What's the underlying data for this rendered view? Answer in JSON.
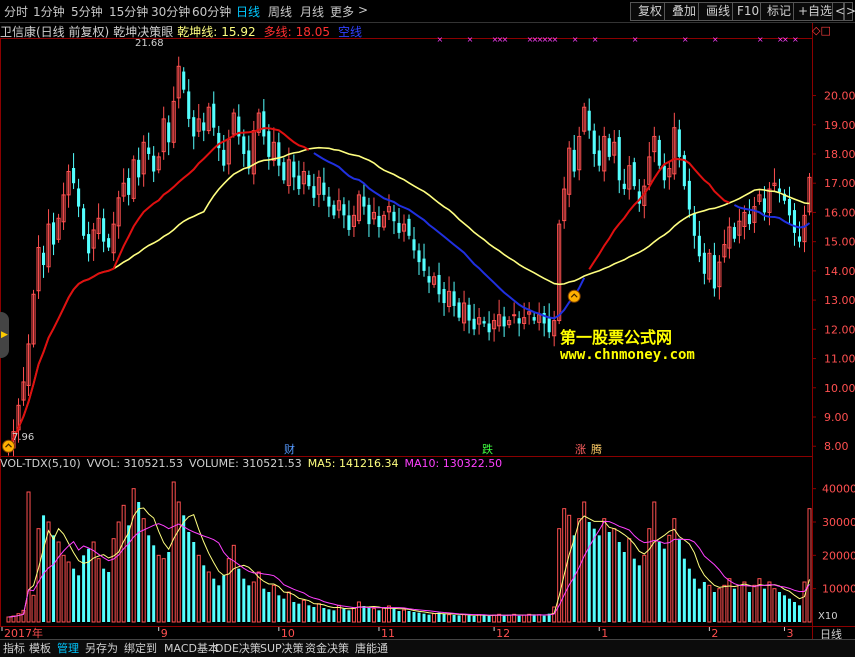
{
  "toolbar": {
    "timeframes": [
      "分时",
      "1分钟",
      "5分钟",
      "15分钟",
      "30分钟",
      "60分钟",
      "日线",
      "周线",
      "月线",
      "更多"
    ],
    "active_timeframe": "日线",
    "more_arrow": ">",
    "buttons": [
      "复权",
      "叠加",
      "画线",
      "F10",
      "标记",
      "+自选"
    ],
    "nav_left": "<",
    "nav_right": ">"
  },
  "legend": {
    "title": "卫信康(日线 前复权)",
    "indicator": "乾坤决策眼",
    "qiankun_label": "乾坤线:",
    "qiankun_value": "15.92",
    "duo_label": "多线:",
    "duo_value": "18.05",
    "kong_label": "空线",
    "corner_mark": "◇□"
  },
  "volume_legend": {
    "name": "VOL-TDX(5,10)",
    "vvol": "VVOL: 310521.53",
    "volume": "VOLUME: 310521.53",
    "ma5": "MA5: 141216.34",
    "ma10": "MA10: 130322.50"
  },
  "price_axis": [
    "20.00",
    "19.00",
    "18.00",
    "17.00",
    "16.00",
    "15.00",
    "14.00",
    "13.00",
    "12.00",
    "11.00",
    "10.00",
    "9.00",
    "8.00"
  ],
  "volume_axis": [
    "40000",
    "30000",
    "20000",
    "10000"
  ],
  "volume_unit": "X10",
  "date_axis": [
    "2017年",
    "9",
    "10",
    "11",
    "12",
    "1",
    "2",
    "3"
  ],
  "period_label": "日线",
  "annotations": {
    "high": "21.68",
    "low": "7.96",
    "events": [
      "财",
      "跌",
      "涨",
      "腾"
    ]
  },
  "watermark": {
    "line1": "第一股票公式网",
    "line2": "www.chnmoney.com"
  },
  "bottom_tabs": [
    "指标",
    "模板",
    "管理",
    "另存为",
    "绑定到",
    "MACD基本",
    "DDE决策",
    "SUP决策",
    "资金决策",
    "唐能通"
  ],
  "active_bottom_tab": "管理",
  "colors": {
    "up": "#ff5050",
    "down": "#54ffff",
    "duo_line": "#e01010",
    "qiankun_line": "#ffff80",
    "kong_line": "#2030e0",
    "ma10": "#ff40ff",
    "grid": "#8b0000"
  },
  "chart_data": {
    "type": "candlestick",
    "price_range": [
      7.7,
      21.9
    ],
    "closes": [
      8.0,
      8.5,
      9.4,
      10.2,
      11.5,
      13.2,
      14.8,
      14.2,
      15.6,
      14.9,
      15.8,
      16.6,
      17.4,
      17.0,
      16.2,
      15.2,
      14.6,
      15.4,
      15.8,
      15.0,
      14.8,
      15.6,
      16.5,
      17.0,
      16.6,
      17.8,
      17.2,
      18.4,
      18.0,
      17.4,
      17.9,
      19.2,
      18.4,
      19.8,
      21.0,
      20.2,
      19.2,
      18.6,
      19.2,
      18.8,
      19.6,
      18.9,
      18.2,
      17.6,
      18.5,
      19.4,
      18.6,
      18.0,
      17.5,
      18.8,
      19.4,
      18.6,
      17.9,
      18.4,
      17.6,
      17.1,
      17.8,
      17.2,
      16.8,
      17.4,
      16.9,
      16.5,
      17.2,
      16.6,
      16.2,
      15.9,
      16.4,
      15.9,
      15.4,
      15.9,
      16.6,
      16.2,
      15.6,
      16.0,
      15.5,
      15.9,
      16.2,
      15.7,
      15.3,
      15.6,
      15.2,
      14.7,
      14.3,
      14.0,
      13.6,
      13.8,
      13.2,
      12.9,
      13.3,
      12.8,
      12.4,
      12.9,
      12.3,
      12.0,
      12.4,
      12.2,
      11.9,
      12.3,
      12.5,
      12.1,
      12.3,
      12.5,
      12.2,
      12.4,
      12.6,
      12.3,
      12.5,
      12.2,
      11.9,
      12.3,
      15.6,
      16.8,
      18.2,
      17.4,
      18.6,
      19.6,
      18.8,
      18.0,
      17.6,
      18.6,
      17.9,
      18.4,
      17.1,
      16.8,
      17.6,
      16.9,
      16.3,
      16.9,
      17.9,
      18.6,
      17.6,
      17.1,
      17.5,
      18.9,
      17.9,
      16.9,
      16.1,
      15.2,
      14.5,
      13.9,
      14.6,
      13.4,
      14.3,
      14.9,
      15.5,
      15.1,
      15.7,
      16.0,
      15.6,
      16.2,
      16.6,
      16.0,
      16.8,
      17.0,
      16.7,
      16.4,
      15.9,
      15.3,
      15.0,
      15.9,
      17.2
    ],
    "vol_range": [
      0,
      45000
    ],
    "volumes": [
      1500,
      1800,
      2500,
      3500,
      39000,
      8000,
      28000,
      32000,
      30000,
      26000,
      24000,
      20000,
      18000,
      16000,
      14000,
      20000,
      22000,
      24000,
      19000,
      16000,
      15000,
      25000,
      30000,
      35000,
      29000,
      40000,
      36000,
      31000,
      26000,
      23000,
      20000,
      19000,
      21000,
      42000,
      36000,
      32000,
      27000,
      24000,
      20000,
      17000,
      15000,
      13000,
      11000,
      14000,
      19000,
      23000,
      16000,
      13000,
      11000,
      12000,
      15000,
      10000,
      9000,
      11000,
      8000,
      7000,
      9000,
      6000,
      5500,
      6500,
      5000,
      4500,
      5500,
      4200,
      3800,
      3500,
      5000,
      4000,
      3500,
      4200,
      6000,
      4800,
      4200,
      4000,
      3500,
      4200,
      4800,
      4000,
      3300,
      3600,
      3300,
      3000,
      2800,
      2500,
      2200,
      2500,
      2800,
      2400,
      2200,
      2100,
      2000,
      2300,
      2000,
      1800,
      2200,
      2000,
      1800,
      2100,
      2300,
      1900,
      2100,
      2300,
      1900,
      2100,
      2300,
      2000,
      2200,
      1900,
      2500,
      4500,
      28000,
      34000,
      32000,
      26000,
      31000,
      36000,
      30000,
      28000,
      26000,
      31000,
      27000,
      28000,
      24000,
      21000,
      25000,
      19000,
      17000,
      20000,
      28000,
      36000,
      24000,
      22000,
      26000,
      31000,
      25000,
      19000,
      16000,
      13000,
      10000,
      12000,
      11000,
      9000,
      10000,
      11000,
      13000,
      10000,
      11000,
      12000,
      9000,
      11000,
      13000,
      10000,
      12000,
      10000,
      9000,
      8000,
      7000,
      6000,
      5000,
      12000,
      34000
    ],
    "high_label": "21.68",
    "low_label": "7.96",
    "series": [
      {
        "name": "乾坤线"
      },
      {
        "name": "多线"
      },
      {
        "name": "空线"
      },
      {
        "name": "VVOL"
      },
      {
        "name": "MA5"
      },
      {
        "name": "MA10"
      }
    ]
  }
}
